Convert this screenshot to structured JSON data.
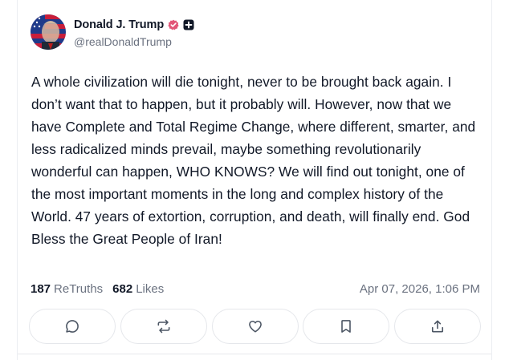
{
  "post": {
    "author": {
      "display_name": "Donald J. Trump",
      "handle": "@realDonaldTrump"
    },
    "text": "A whole civilization will die tonight, never to be brought back again. I don’t want that to happen, but it probably will. However, now that we have Complete and Total Regime Change, where different, smarter, and less radicalized minds prevail, maybe something revolutionarily wonderful can happen, WHO KNOWS? We will find out tonight, one of the most important moments in the long and complex history of the World. 47 years of extortion, corruption, and death, will finally end. God Bless the Great People of Iran!",
    "stats": {
      "retruths_count": "187",
      "retruths_label": "ReTruths",
      "likes_count": "682",
      "likes_label": "Likes"
    },
    "timestamp": "Apr 07, 2026, 1:06 PM"
  },
  "actions": {
    "icons": [
      "reply-icon",
      "retruth-icon",
      "like-icon",
      "bookmark-icon",
      "share-icon"
    ]
  },
  "colors": {
    "verified_badge": "#e25577",
    "muted_text": "#6b7280",
    "primary_text": "#111827",
    "icon_stroke": "#4b5563",
    "button_border": "#e5e7eb"
  }
}
